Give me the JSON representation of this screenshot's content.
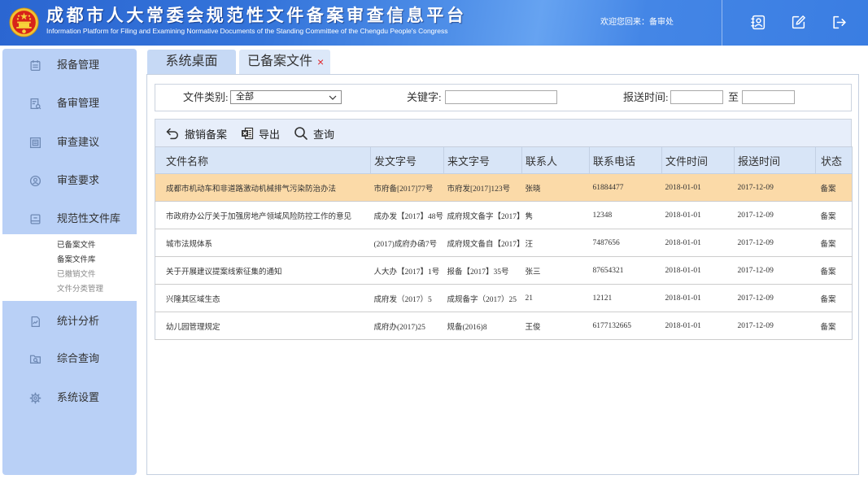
{
  "header": {
    "title": "成都市人大常委会规范性文件备案审查信息平台",
    "subtitle": "Information Platform for Filing and Examining Normative Documents of the Standing Committee of the Chengdu People's Congress",
    "welcome": "欢迎您回来：备审处",
    "logo_icon": "national-emblem-icon",
    "icons": [
      "profile-card-icon",
      "edit-icon",
      "logout-icon"
    ]
  },
  "sidebar": {
    "items": [
      {
        "label": "报备管理",
        "icon": "calendar-list-icon"
      },
      {
        "label": "备审管理",
        "icon": "document-search-icon"
      },
      {
        "label": "审查建议",
        "icon": "framed-document-icon"
      },
      {
        "label": "审查要求",
        "icon": "user-circle-icon"
      },
      {
        "label": "规范性文件库",
        "icon": "archive-box-icon",
        "expanded": true
      },
      {
        "label": "统计分析",
        "icon": "chart-document-icon"
      },
      {
        "label": "综合查询",
        "icon": "folder-search-icon"
      },
      {
        "label": "系统设置",
        "icon": "gear-icon"
      }
    ],
    "sub_items": [
      {
        "label": "已备案文件",
        "dimmed": false
      },
      {
        "label": "备案文件库",
        "dimmed": false
      },
      {
        "label": "已撤销文件",
        "dimmed": true
      },
      {
        "label": "文件分类管理",
        "dimmed": true
      }
    ]
  },
  "tabs": [
    {
      "label": "系统桌面",
      "active": false
    },
    {
      "label": "已备案文件",
      "active": true,
      "close_symbol": "×"
    }
  ],
  "filter": {
    "category_label": "文件类别:",
    "category_value": "全部",
    "keyword_label": "关键字:",
    "keyword_value": "",
    "submit_time_label": "报送时间:",
    "submit_time_from": "",
    "to_label": "至",
    "submit_time_to": ""
  },
  "toolbar": {
    "revoke_label": "撤销备案",
    "revoke_icon": "undo-icon",
    "export_label": "导出",
    "export_icon": "excel-icon",
    "query_label": "查询",
    "query_icon": "search-icon"
  },
  "table": {
    "columns": [
      "文件名称",
      "发文字号",
      "来文字号",
      "联系人",
      "联系电话",
      "文件时间",
      "报送时间",
      "状态"
    ],
    "rows": [
      {
        "name": "成都市机动车和非道路激动机械排气污染防治办法",
        "doc_no": "市府备[2017]77号",
        "incoming_no": "市府发[2017]123号",
        "contact": "张晓",
        "phone": "61884477",
        "file_date": "2018-01-01",
        "submit_date": "2017-12-09",
        "status": "备案",
        "selected": true
      },
      {
        "name": "市政府办公厅关于加强房地产领域风险防控工作的意见",
        "doc_no": "成办发【2017】48号",
        "incoming_no": "成府规文备字【2017】",
        "contact": "隽",
        "phone": "12348",
        "file_date": "2018-01-01",
        "submit_date": "2017-12-09",
        "status": "备案"
      },
      {
        "name": "城市法规体系",
        "doc_no": "(2017)成府办函7号",
        "incoming_no": "成府规文备自【2017】",
        "contact": "汪",
        "phone": "7487656",
        "file_date": "2018-01-01",
        "submit_date": "2017-12-09",
        "status": "备案"
      },
      {
        "name": "关于开展建议提案线索征集的通知",
        "doc_no": "人大办【2017】1号",
        "incoming_no": "报备【2017】35号",
        "contact": "张三",
        "phone": "87654321",
        "file_date": "2018-01-01",
        "submit_date": "2017-12-09",
        "status": "备案"
      },
      {
        "name": "兴隆其区域生态",
        "doc_no": "成府发（2017）5",
        "incoming_no": "成规备字（2017）25",
        "contact": "21",
        "phone": "12121",
        "file_date": "2018-01-01",
        "submit_date": "2017-12-09",
        "status": "备案"
      },
      {
        "name": "幼儿园管理规定",
        "doc_no": "成府办(2017)25",
        "incoming_no": "规备(2016)8",
        "contact": "王俊",
        "phone": "6177132665",
        "file_date": "2018-01-01",
        "submit_date": "2017-12-09",
        "status": "备案"
      }
    ]
  },
  "colors": {
    "header_blue": "#3a7be0",
    "sidebar_blue": "#b9d0f6",
    "table_header": "#d8e5f7",
    "selected_row": "#fbdaa8",
    "close_red": "#e0262a"
  }
}
